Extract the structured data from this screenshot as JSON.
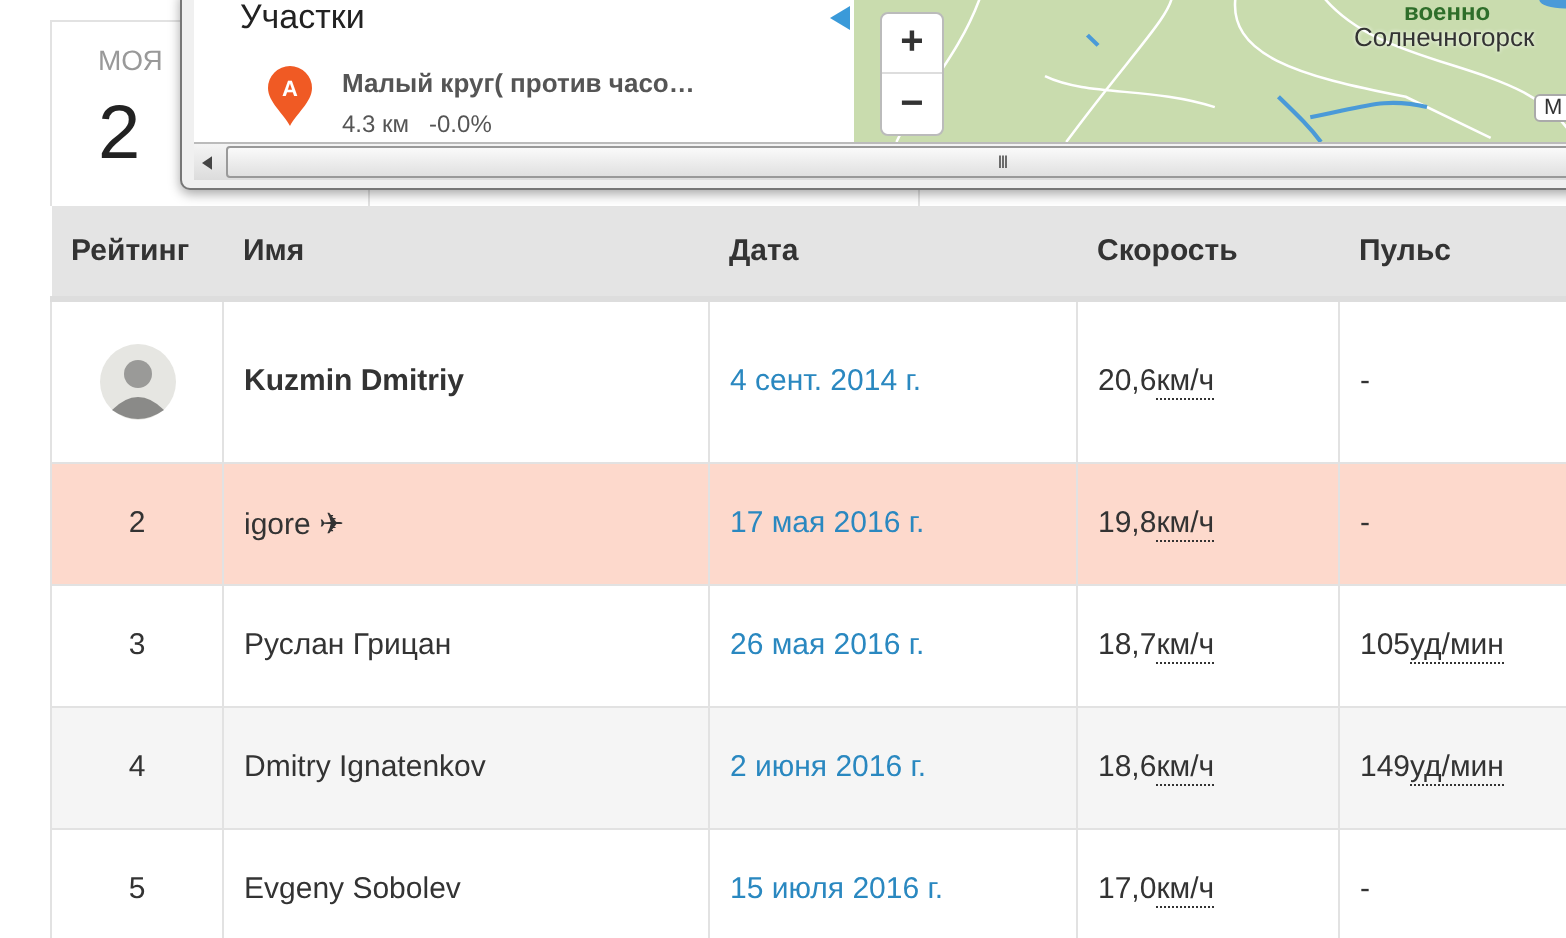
{
  "stat_card": {
    "label": "МОЯ",
    "value": "2"
  },
  "popup": {
    "heading": "Участки",
    "segments": [
      {
        "marker": "A",
        "title": "Малый круг( против часо…",
        "distance": "4.3 км",
        "grade": "-0.0%"
      }
    ],
    "map": {
      "zoom_in": "+",
      "zoom_out": "−",
      "labels": [
        {
          "kind": "place",
          "text": "военно"
        },
        {
          "kind": "city",
          "text": "Солнечногорск"
        },
        {
          "kind": "road",
          "text": "М"
        }
      ]
    },
    "scrollbar": {
      "grip": "III"
    }
  },
  "table": {
    "columns": [
      "Рейтинг",
      "Имя",
      "Дата",
      "Скорость",
      "Пульс"
    ],
    "rows": [
      {
        "kind": "avatar",
        "rank": "",
        "name": "Kuzmin Dmitriy",
        "is_me": true,
        "highlighted": false,
        "name_icon": "",
        "date": "4 сент. 2014 г.",
        "speed": "20,6",
        "speed_unit": "км/ч",
        "pulse": "-",
        "pulse_unit": ""
      },
      {
        "kind": "rank",
        "rank": "2",
        "name": "igore",
        "is_me": false,
        "highlighted": true,
        "name_icon": "✈",
        "date": "17 мая 2016 г.",
        "speed": "19,8",
        "speed_unit": "км/ч",
        "pulse": "-",
        "pulse_unit": ""
      },
      {
        "kind": "rank",
        "rank": "3",
        "name": "Руслан Грицан",
        "is_me": false,
        "highlighted": false,
        "name_icon": "",
        "date": "26 мая 2016 г.",
        "speed": "18,7",
        "speed_unit": "км/ч",
        "pulse": "105",
        "pulse_unit": "уд/мин"
      },
      {
        "kind": "rank",
        "rank": "4",
        "name": "Dmitry Ignatenkov",
        "is_me": false,
        "highlighted": false,
        "name_icon": "",
        "date": "2 июня 2016 г.",
        "speed": "18,6",
        "speed_unit": "км/ч",
        "pulse": "149",
        "pulse_unit": "уд/мин"
      },
      {
        "kind": "rank",
        "rank": "5",
        "name": "Evgeny Sobolev",
        "is_me": false,
        "highlighted": false,
        "name_icon": "",
        "date": "15 июля 2016 г.",
        "speed": "17,0",
        "speed_unit": "км/ч",
        "pulse": "-",
        "pulse_unit": ""
      }
    ]
  }
}
